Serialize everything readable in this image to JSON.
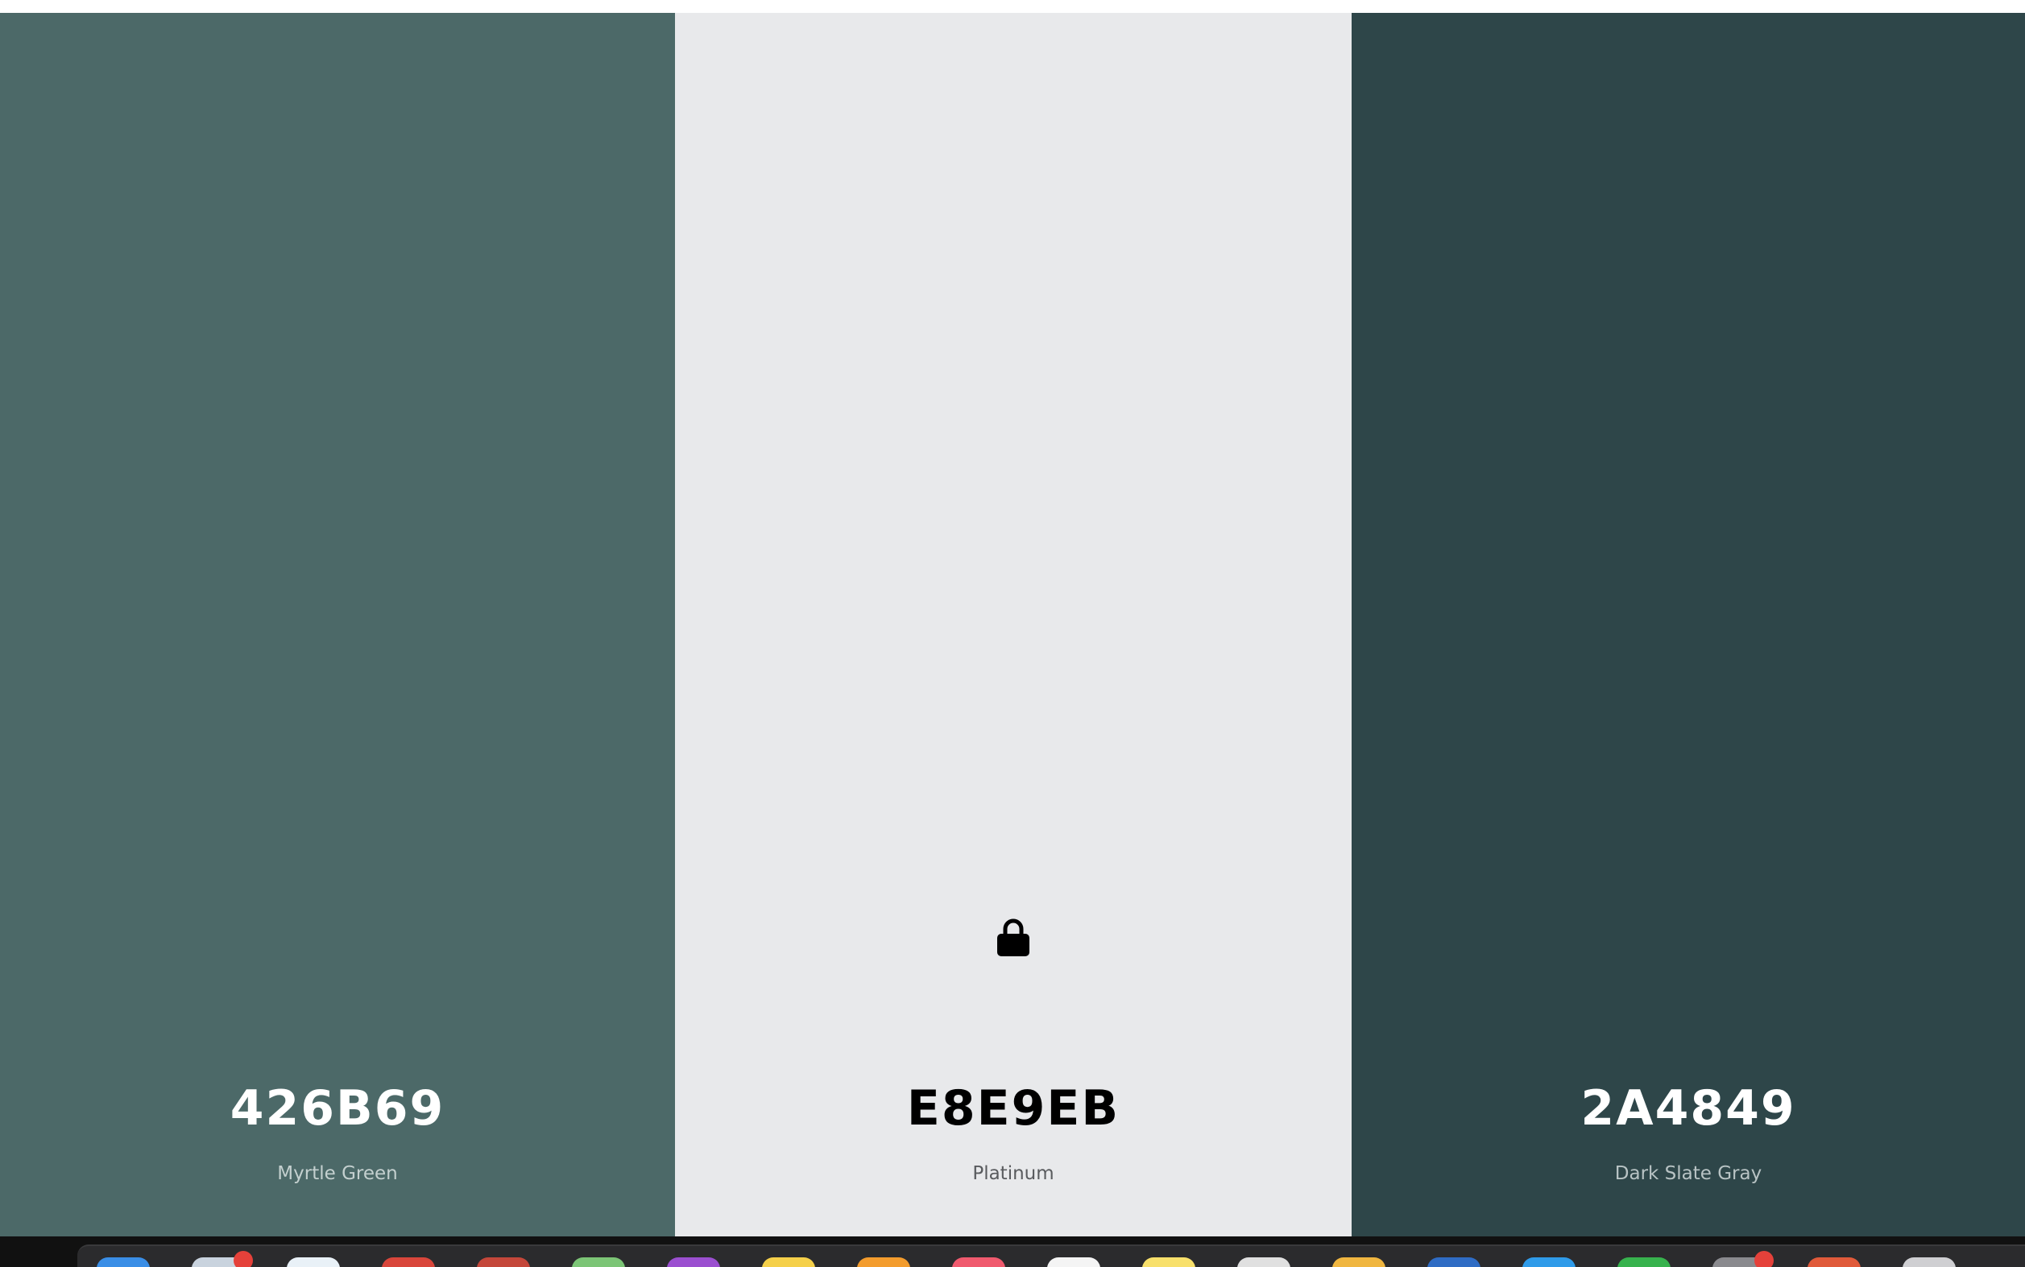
{
  "palette": {
    "colors": [
      {
        "hex": "426B69",
        "name": "Myrtle Green",
        "background": "#4C6968",
        "text_color": "#FFFFFF",
        "name_color": "#C4D0CF",
        "locked": false
      },
      {
        "hex": "E8E9EB",
        "name": "Platinum",
        "background": "#E8E9EB",
        "text_color": "#000000",
        "name_color": "#595B5E",
        "locked": true
      },
      {
        "hex": "2A4849",
        "name": "Dark Slate Gray",
        "background": "#2E4649",
        "text_color": "#FFFFFF",
        "name_color": "#B8C3C4",
        "locked": false
      }
    ]
  },
  "dock": {
    "apps": [
      {
        "icon": "finder-icon",
        "color": "#3a8ee6"
      },
      {
        "icon": "mail-icon",
        "color": "#c9d3de",
        "badge": true
      },
      {
        "icon": "safari-icon",
        "color": "#e9f1f7"
      },
      {
        "icon": "chrome-icon",
        "color": "#d9463b"
      },
      {
        "icon": "powerpoint-icon",
        "color": "#c4473a"
      },
      {
        "icon": "maps-icon",
        "color": "#7cc576"
      },
      {
        "icon": "podcasts-icon",
        "color": "#9b4fd0"
      },
      {
        "icon": "notes-icon",
        "color": "#f5d04a"
      },
      {
        "icon": "pages-icon",
        "color": "#f39c2d"
      },
      {
        "icon": "music-icon",
        "color": "#f05a6e"
      },
      {
        "icon": "calendar-icon",
        "color": "#f4f4f4"
      },
      {
        "icon": "stickies-icon",
        "color": "#f8e06b"
      },
      {
        "icon": "preview-icon",
        "color": "#e0e0e0"
      },
      {
        "icon": "photos-icon",
        "color": "#f0b640"
      },
      {
        "icon": "word-icon",
        "color": "#2f6cc4"
      },
      {
        "icon": "app-store-icon",
        "color": "#2f9be9"
      },
      {
        "icon": "numbers-icon",
        "color": "#37b24d"
      },
      {
        "icon": "system-preferences-icon",
        "color": "#8a8a8e",
        "badge": true
      },
      {
        "icon": "launchpad-icon",
        "color": "#e05a3a"
      },
      {
        "icon": "trash-icon",
        "color": "#cfcfd2"
      }
    ]
  }
}
